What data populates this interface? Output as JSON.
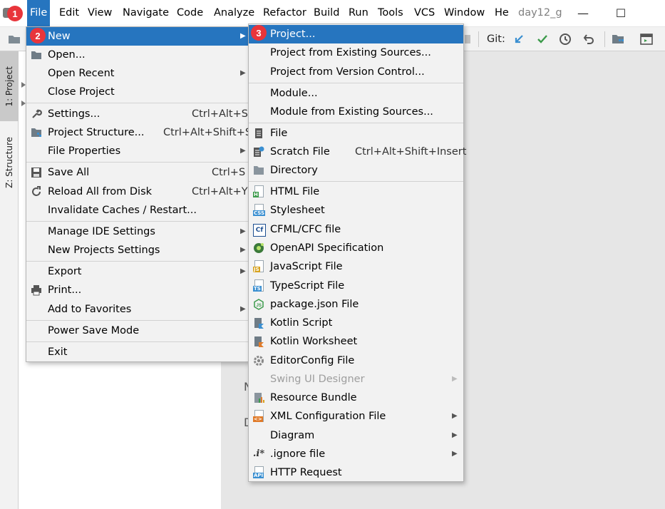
{
  "menubar": {
    "items": [
      "File",
      "Edit",
      "View",
      "Navigate",
      "Code",
      "Analyze",
      "Refactor",
      "Build",
      "Run",
      "Tools",
      "VCS",
      "Window",
      "He"
    ],
    "project_name": "day12_g",
    "minimize": "—",
    "maximize": "☐"
  },
  "toolbar": {
    "git_label": "Git:"
  },
  "side_tabs": {
    "project": "1: Project",
    "structure": "Z: Structure"
  },
  "editor_hints": [
    "N",
    "D"
  ],
  "badges": [
    "1",
    "2",
    "3"
  ],
  "file_menu": {
    "items": [
      {
        "label": "New",
        "submenu": true
      },
      {
        "label": "Open..."
      },
      {
        "label": "Open Recent",
        "submenu": true
      },
      {
        "label": "Close Project"
      },
      {
        "label": "Settings...",
        "shortcut": "Ctrl+Alt+S"
      },
      {
        "label": "Project Structure...",
        "shortcut": "Ctrl+Alt+Shift+S"
      },
      {
        "label": "File Properties",
        "submenu": true
      },
      {
        "label": "Save All",
        "shortcut": "Ctrl+S"
      },
      {
        "label": "Reload All from Disk",
        "shortcut": "Ctrl+Alt+Y"
      },
      {
        "label": "Invalidate Caches / Restart..."
      },
      {
        "label": "Manage IDE Settings",
        "submenu": true
      },
      {
        "label": "New Projects Settings",
        "submenu": true
      },
      {
        "label": "Export",
        "submenu": true
      },
      {
        "label": "Print..."
      },
      {
        "label": "Add to Favorites",
        "submenu": true
      },
      {
        "label": "Power Save Mode"
      },
      {
        "label": "Exit"
      }
    ]
  },
  "new_menu": {
    "items": [
      {
        "label": "Project..."
      },
      {
        "label": "Project from Existing Sources..."
      },
      {
        "label": "Project from Version Control..."
      },
      {
        "label": "Module..."
      },
      {
        "label": "Module from Existing Sources..."
      },
      {
        "label": "File"
      },
      {
        "label": "Scratch File",
        "shortcut": "Ctrl+Alt+Shift+Insert"
      },
      {
        "label": "Directory"
      },
      {
        "label": "HTML File"
      },
      {
        "label": "Stylesheet"
      },
      {
        "label": "CFML/CFC file"
      },
      {
        "label": "OpenAPI Specification"
      },
      {
        "label": "JavaScript File"
      },
      {
        "label": "TypeScript File"
      },
      {
        "label": "package.json File"
      },
      {
        "label": "Kotlin Script"
      },
      {
        "label": "Kotlin Worksheet"
      },
      {
        "label": "EditorConfig File"
      },
      {
        "label": "Swing UI Designer",
        "submenu": true,
        "disabled": true
      },
      {
        "label": "Resource Bundle"
      },
      {
        "label": "XML Configuration File",
        "submenu": true
      },
      {
        "label": "Diagram",
        "submenu": true
      },
      {
        "label": ".ignore file",
        "submenu": true
      },
      {
        "label": "HTTP Request"
      }
    ]
  },
  "icons": {
    "icon_tags": {
      "html": "H",
      "css": "CSS",
      "cfml": "Cf",
      "js": "JS",
      "ts": "TS",
      "json": "JS",
      "xml": "<>",
      "api": "API",
      "ignore": ".i*"
    }
  },
  "colors": {
    "accent": "#2675bf",
    "badge": "#e8353b",
    "menu_bg": "#f2f2f2"
  }
}
